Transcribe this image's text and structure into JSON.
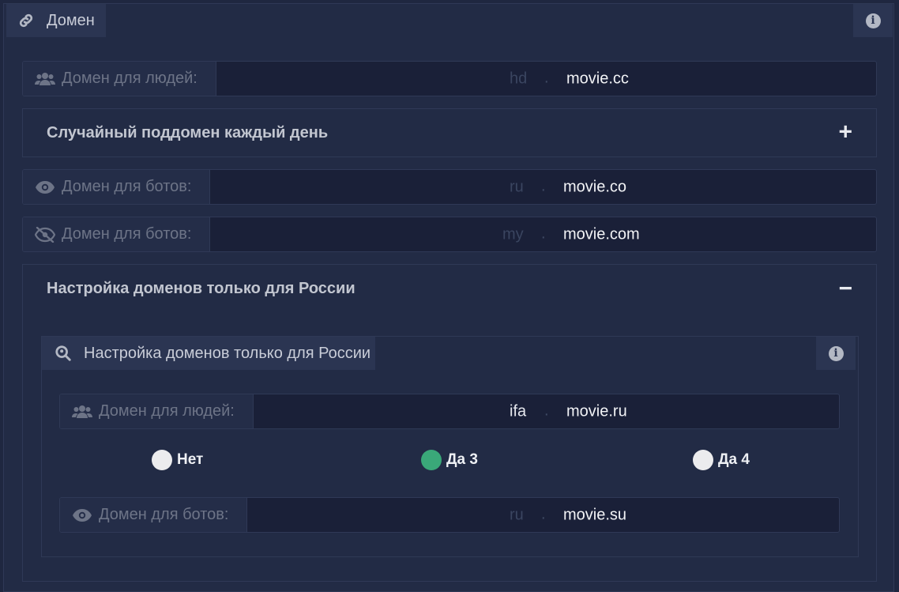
{
  "panel": {
    "title": "Домен",
    "icon": "link-icon"
  },
  "human_domain": {
    "label": "Домен для людей:",
    "icon": "users-icon",
    "subdomain": "hd",
    "dot": ".",
    "domain": "movie.cc"
  },
  "random_subdomain": {
    "title": "Случайный поддомен каждый день",
    "toggle": "+"
  },
  "bot_domain_1": {
    "label": "Домен для ботов:",
    "icon": "eye-icon",
    "subdomain": "ru",
    "dot": ".",
    "domain": "movie.co"
  },
  "bot_domain_2": {
    "label": "Домен для ботов:",
    "icon": "eye-slash-icon",
    "subdomain": "my",
    "dot": ".",
    "domain": "movie.com"
  },
  "russia_section": {
    "title": "Настройка доменов только для России",
    "toggle": "−"
  },
  "russia_panel": {
    "title": "Настройка доменов только для России",
    "icon": "search-location-icon",
    "human_domain": {
      "label": "Домен для людей:",
      "icon": "users-icon",
      "subdomain": "ifa",
      "dot": ".",
      "domain": "movie.ru"
    },
    "radios": [
      {
        "label": "Нет",
        "selected": false
      },
      {
        "label": "Да 3",
        "selected": true
      },
      {
        "label": "Да 4",
        "selected": false
      }
    ],
    "bot_domain": {
      "label": "Домен для ботов:",
      "icon": "eye-icon",
      "subdomain": "ru",
      "dot": ".",
      "domain": "movie.su"
    }
  },
  "colors": {
    "accent": "#3aa879",
    "background": "#222b45",
    "field": "#1a2038"
  }
}
